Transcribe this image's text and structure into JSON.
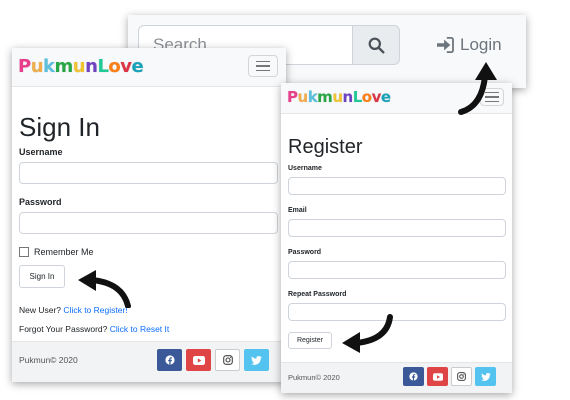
{
  "search": {
    "placeholder": "Search"
  },
  "nav": {
    "login_label": "Login"
  },
  "brand": {
    "letters": [
      "P",
      "u",
      "k",
      "m",
      "u",
      "n",
      "L",
      "o",
      "v",
      "e"
    ],
    "colors": [
      "#e83e8c",
      "#f0ad4e",
      "#5bc0de",
      "#28a745",
      "#f0c330",
      "#6f42c1",
      "#20c997",
      "#fd7e14",
      "#dc3545",
      "#17a2b8"
    ]
  },
  "signin": {
    "title": "Sign In",
    "username_label": "Username",
    "password_label": "Password",
    "remember_label": "Remember Me",
    "button_label": "Sign In",
    "new_user_text": "New User?",
    "register_link": "Click to Register!",
    "forgot_text": "Forgot Your Password?",
    "reset_link": "Click to Reset It"
  },
  "register": {
    "title": "Register",
    "username_label": "Username",
    "email_label": "Email",
    "password_label": "Password",
    "repeat_password_label": "Repeat Password",
    "button_label": "Register"
  },
  "footer": {
    "copyright": "Pukmun© 2020",
    "social_icons": [
      "facebook-icon",
      "youtube-icon",
      "instagram-icon",
      "twitter-icon"
    ]
  }
}
